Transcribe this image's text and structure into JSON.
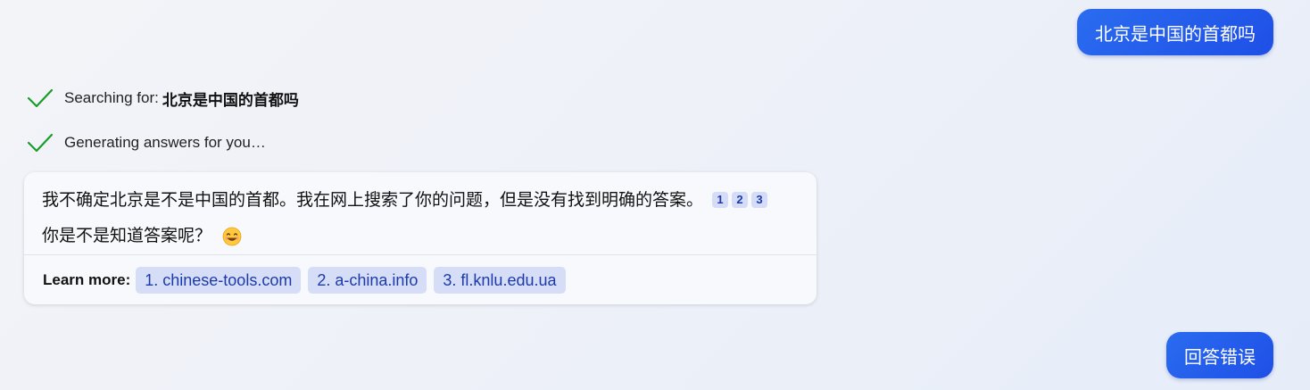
{
  "messages": {
    "user_query": "北京是中国的首都吗",
    "user_followup": "回答错误"
  },
  "status": {
    "searching_prefix": "Searching for:",
    "searching_query": "北京是中国的首都吗",
    "generating": "Generating answers for you…"
  },
  "answer": {
    "line1": "我不确定北京是不是中国的首都。我在网上搜索了你的问题，但是没有找到明确的答案。",
    "citations": [
      "1",
      "2",
      "3"
    ],
    "line2": "你是不是知道答案呢？",
    "emoji_icon": "smiling-face-icon"
  },
  "learn_more": {
    "label": "Learn more:",
    "sources": [
      "1. chinese-tools.com",
      "2. a-china.info",
      "3. fl.knlu.edu.ua"
    ]
  },
  "colors": {
    "accent": "#2563eb",
    "check_green": "#1a9c2a",
    "chip_bg": "#d6def7",
    "chip_text": "#1d3aa8"
  }
}
